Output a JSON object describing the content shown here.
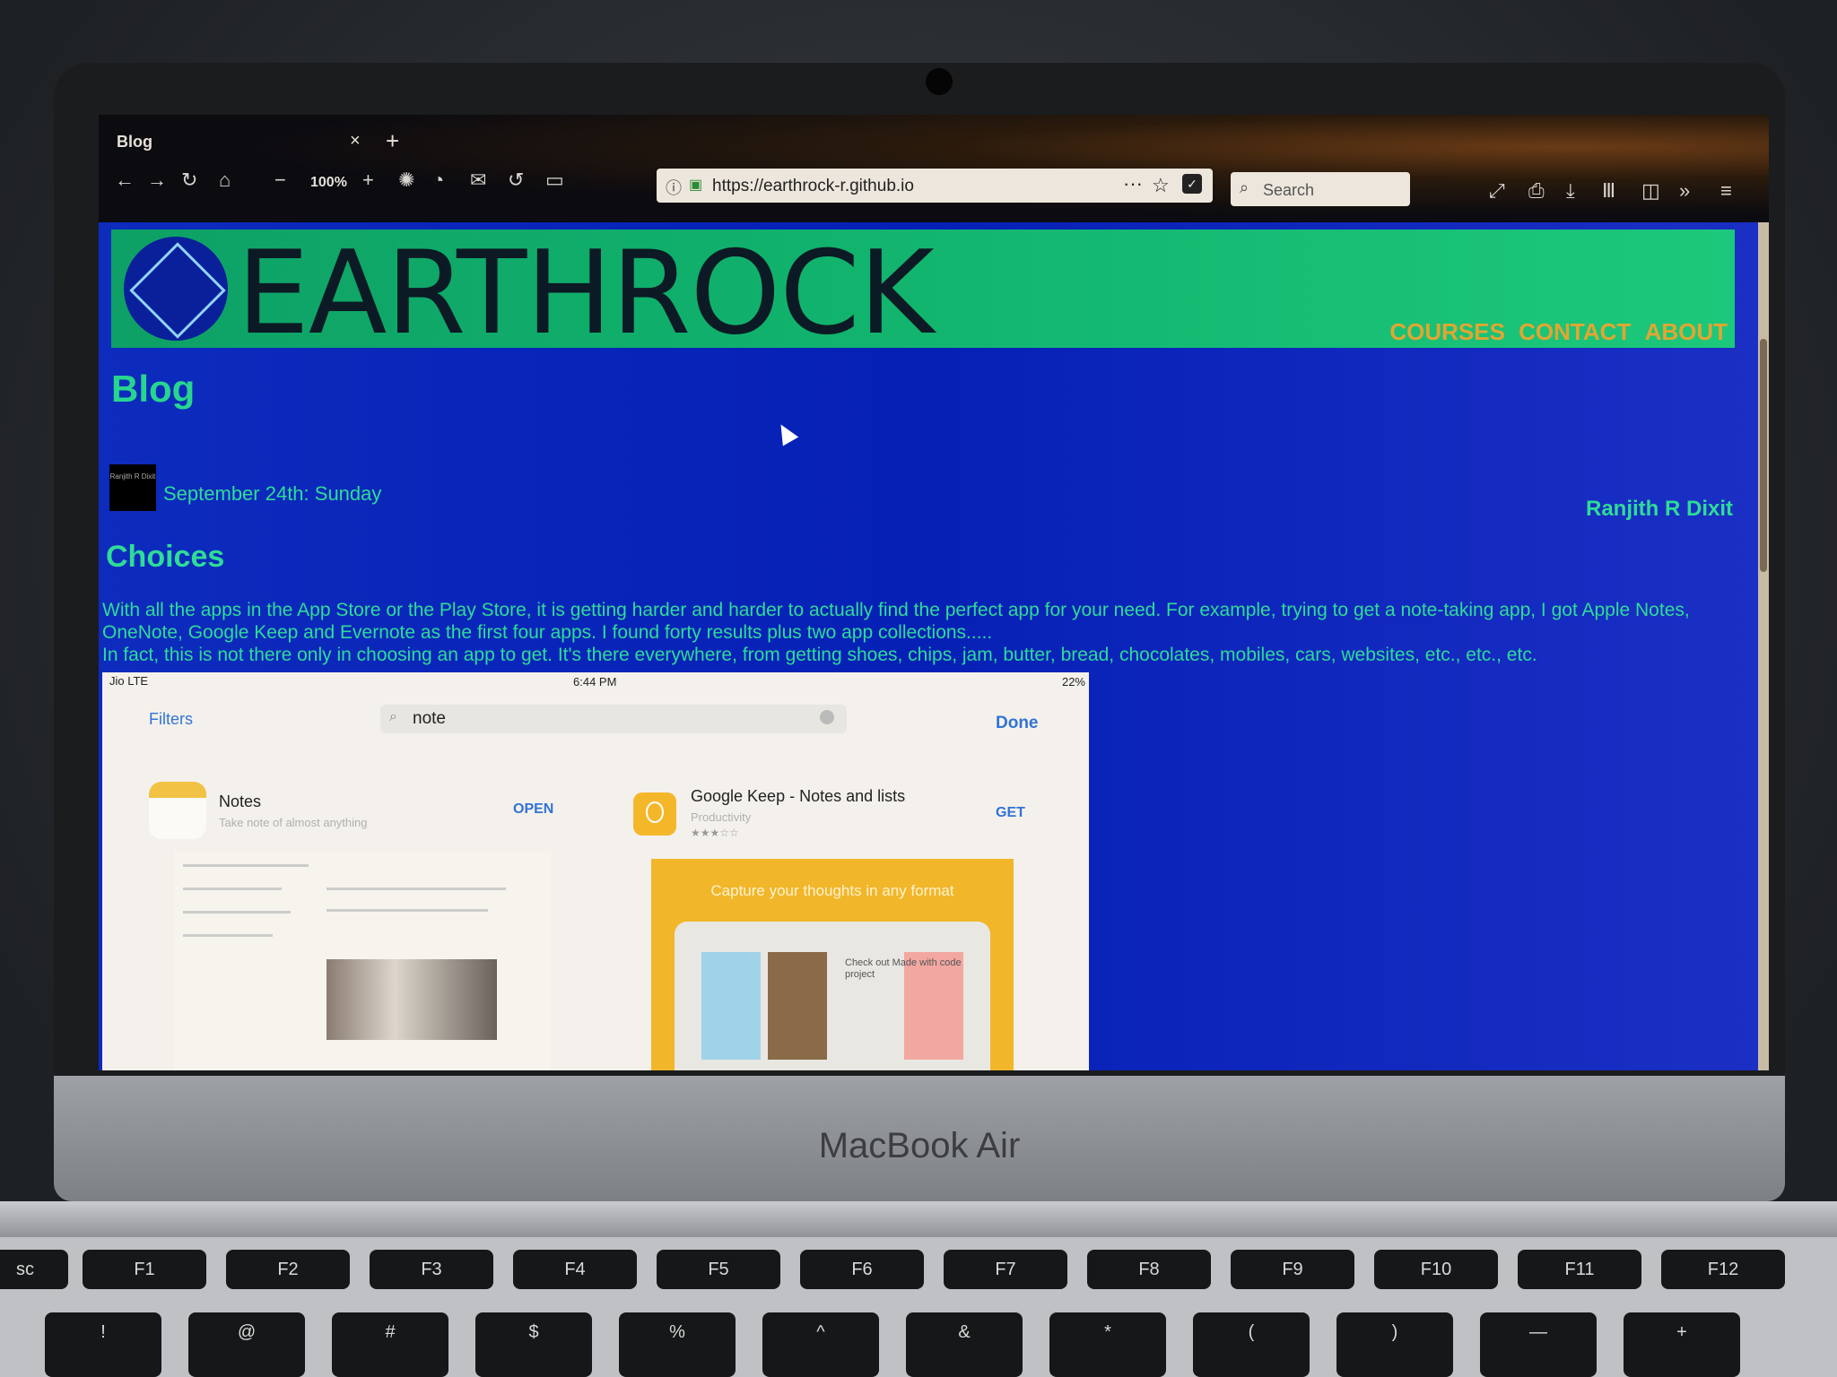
{
  "device": {
    "brand": "MacBook Air"
  },
  "browser": {
    "tab_title": "Blog",
    "tab_close": "×",
    "new_tab": "+",
    "zoom_level": "100%",
    "url": "https://earthrock-r.github.io",
    "search_placeholder": "Search",
    "icons": [
      "back-icon",
      "forward-icon",
      "reload-icon",
      "home-icon",
      "zoom-out-icon",
      "zoom-in-icon",
      "settings-icon",
      "screenshot-icon",
      "email-icon",
      "history-icon",
      "folder-icon",
      "info-icon",
      "lock-icon",
      "more-icon",
      "bookmark-star-icon",
      "pocket-icon",
      "search-icon",
      "fullscreen-icon",
      "print-icon",
      "download-icon",
      "library-icon",
      "sidebar-icon",
      "overflow-icon",
      "menu-icon"
    ]
  },
  "site": {
    "title": "EARTHROCK",
    "nav": [
      "COURSES",
      "CONTACT",
      "ABOUT"
    ],
    "page_heading": "Blog",
    "colors": {
      "header_green": "#11b36d",
      "page_blue": "#0620b6",
      "text_green": "#2edc97",
      "nav_gold": "#e1a632"
    }
  },
  "post": {
    "avatar_text": "Ranjith R Dixit",
    "date": "September 24th: Sunday",
    "author": "Ranjith R Dixit",
    "title": "Choices",
    "body_1": "With all the apps in the App Store or the Play Store, it is getting harder and harder to actually find the perfect app for your need. For example, trying to get a note-taking app, I got Apple Notes, OneNote, Google Keep and Evernote as the first four apps. I found forty results plus two app collections.....",
    "body_2": "In fact, this is not there only in choosing an app to get. It's there everywhere, from getting shoes, chips, jam, butter, bread, chocolates, mobiles, cars, websites, etc., etc., etc."
  },
  "embedded_screenshot": {
    "status_left": "Jio  LTE",
    "status_time": "6:44 PM",
    "status_right": "22%",
    "filters_label": "Filters",
    "search_value": "note",
    "done_label": "Done",
    "app1": {
      "name": "Notes",
      "subtitle": "Take note of almost anything",
      "button": "OPEN"
    },
    "app2": {
      "name": "Google Keep - Notes and lists",
      "subtitle": "Productivity",
      "stars": "★★★☆☆",
      "button": "GET"
    },
    "keep_caption": "Capture your thoughts in any format",
    "keep_note_text": "Check out\nMade with\ncode project"
  },
  "keyboard": {
    "fn_row": [
      "sc",
      "F1",
      "F2",
      "F3",
      "F4",
      "F5",
      "F6",
      "F7",
      "F8",
      "F9",
      "F10",
      "F11",
      "F12"
    ],
    "num_row": [
      "!",
      "@",
      "#",
      "$",
      "%",
      "^",
      "&",
      "*",
      "(",
      ")",
      "—",
      "+"
    ]
  }
}
